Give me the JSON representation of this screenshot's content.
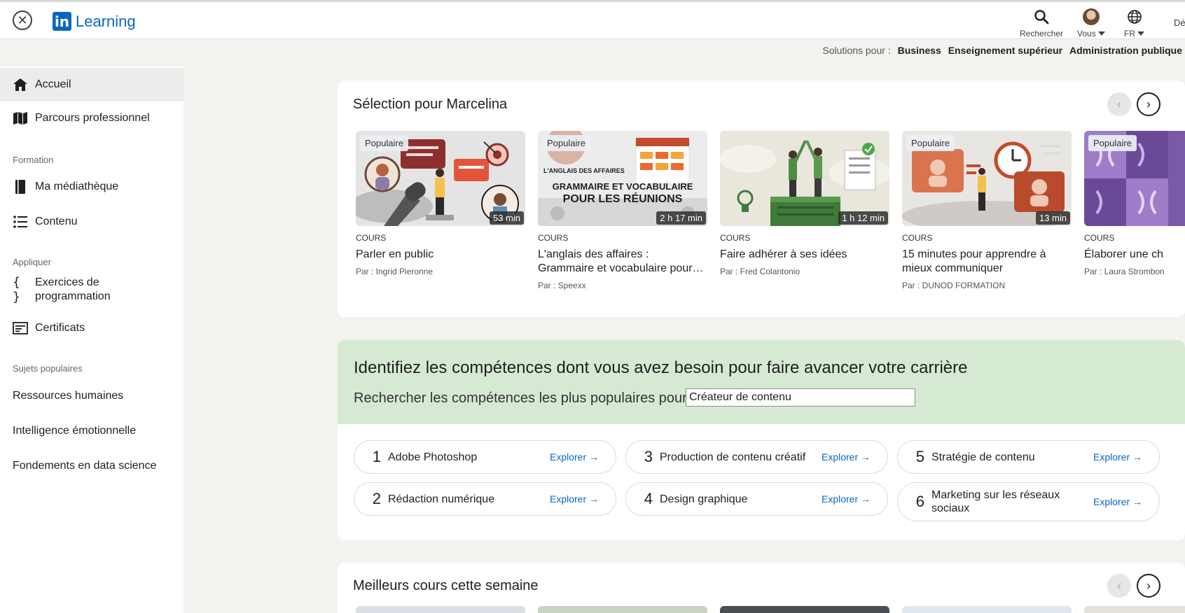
{
  "header": {
    "close_label": "✕",
    "logo_in": "in",
    "logo_text": "Learning",
    "search_label": "Rechercher",
    "you_label": "Vous",
    "lang_label": "FR",
    "cut_label": "Dé"
  },
  "solutions": {
    "prefix": "Solutions pour :",
    "links": [
      "Business",
      "Enseignement supérieur",
      "Administration publique"
    ]
  },
  "sidebar": {
    "items": [
      {
        "label": "Accueil",
        "icon": "home-icon"
      },
      {
        "label": "Parcours professionnel",
        "icon": "map-icon"
      },
      {
        "label": "Ma médiathèque",
        "icon": "book-icon"
      },
      {
        "label": "Contenu",
        "icon": "list-icon"
      },
      {
        "label": "Exercices de programmation",
        "icon": "code-icon"
      },
      {
        "label": "Certificats",
        "icon": "certificate-icon"
      }
    ],
    "sections": [
      "Formation",
      "Appliquer",
      "Sujets populaires"
    ],
    "topics": [
      "Ressources humaines",
      "Intelligence émotionnelle",
      "Fondements en data science"
    ]
  },
  "selection": {
    "title": "Sélection pour Marcelina",
    "prev": "‹",
    "next": "›",
    "courses": [
      {
        "badge": "Populaire",
        "duration": "53 min",
        "type": "COURS",
        "title": "Parler en public",
        "author": "Par : Ingrid Pieronne"
      },
      {
        "badge": "Populaire",
        "duration": "2 h 17 min",
        "type": "COURS",
        "title": "L'anglais des affaires : Grammaire et vocabulaire pour…",
        "author": "Par : Speexx",
        "thumb_caption": "L'ANGLAIS DES AFFAIRES",
        "thumb_line1": "GRAMMAIRE ET VOCABULAIRE",
        "thumb_line2": "POUR LES RÉUNIONS"
      },
      {
        "badge": "",
        "duration": "1 h 12 min",
        "type": "COURS",
        "title": "Faire adhérer à ses idées",
        "author": "Par : Fred Colantonio"
      },
      {
        "badge": "Populaire",
        "duration": "13 min",
        "type": "COURS",
        "title": "15 minutes pour apprendre à mieux communiquer",
        "author": "Par : DUNOD FORMATION"
      },
      {
        "badge": "Populaire",
        "duration": "",
        "type": "COURS",
        "title": "Élaborer une ch",
        "author": "Par : Laura Strombon"
      }
    ]
  },
  "skills": {
    "title": "Identifiez les compétences dont vous avez besoin pour faire avancer votre carrière",
    "subtitle": "Rechercher les compétences les plus populaires pour",
    "input_value": "Créateur de contenu",
    "explore_label": "Explorer →",
    "items": [
      {
        "num": "1",
        "name": "Adobe Photoshop"
      },
      {
        "num": "2",
        "name": "Rédaction numérique"
      },
      {
        "num": "3",
        "name": "Production de contenu créatif"
      },
      {
        "num": "4",
        "name": "Design graphique"
      },
      {
        "num": "5",
        "name": "Stratégie de contenu"
      },
      {
        "num": "6",
        "name": "Marketing sur les réseaux sociaux"
      }
    ]
  },
  "best": {
    "title": "Meilleurs cours cette semaine",
    "prev": "‹",
    "next": "›"
  }
}
